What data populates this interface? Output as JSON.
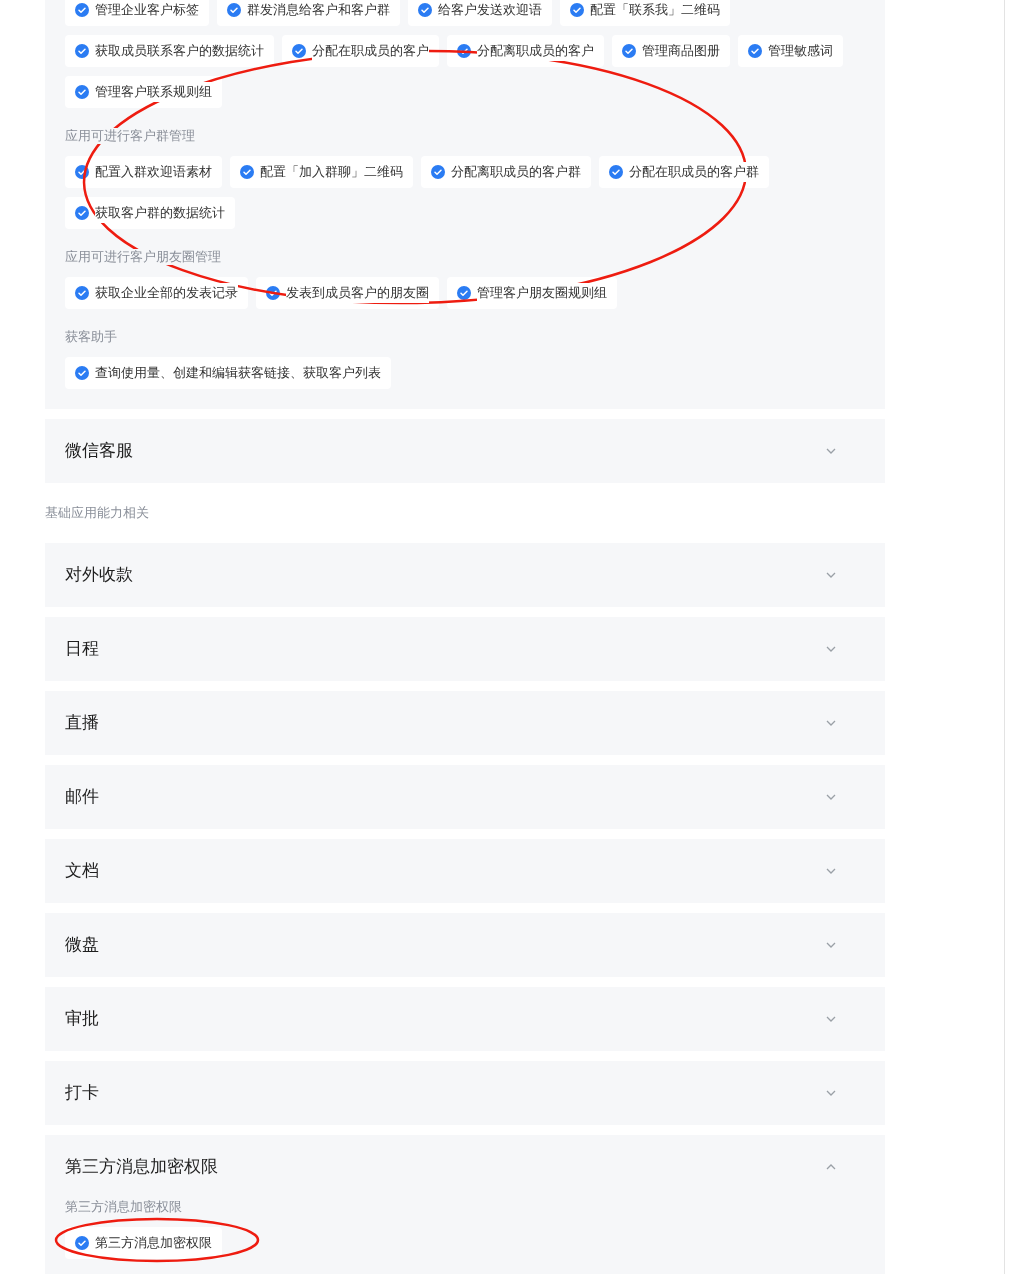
{
  "open_panel": {
    "expanded": true,
    "groups": [
      {
        "items": [
          {
            "label": "管理企业客户标签",
            "checked": true
          },
          {
            "label": "群发消息给客户和客户群",
            "checked": true
          },
          {
            "label": "给客户发送欢迎语",
            "checked": true
          },
          {
            "label": "配置「联系我」二维码",
            "checked": true
          },
          {
            "label": "获取成员联系客户的数据统计",
            "checked": true
          },
          {
            "label": "分配在职成员的客户",
            "checked": true
          },
          {
            "label": "分配离职成员的客户",
            "checked": true
          },
          {
            "label": "管理商品图册",
            "checked": true
          },
          {
            "label": "管理敏感词",
            "checked": true
          },
          {
            "label": "管理客户联系规则组",
            "checked": true
          }
        ]
      },
      {
        "label": "应用可进行客户群管理",
        "items": [
          {
            "label": "配置入群欢迎语素材",
            "checked": true
          },
          {
            "label": "配置「加入群聊」二维码",
            "checked": true
          },
          {
            "label": "分配离职成员的客户群",
            "checked": true
          },
          {
            "label": "分配在职成员的客户群",
            "checked": true
          },
          {
            "label": "获取客户群的数据统计",
            "checked": true
          }
        ]
      },
      {
        "label": "应用可进行客户朋友圈管理",
        "items": [
          {
            "label": "获取企业全部的发表记录",
            "checked": true
          },
          {
            "label": "发表到成员客户的朋友圈",
            "checked": true
          },
          {
            "label": "管理客户朋友圈规则组",
            "checked": true
          }
        ]
      },
      {
        "label": "获客助手",
        "items": [
          {
            "label": "查询使用量、创建和编辑获客链接、获取客户列表",
            "checked": true
          }
        ]
      }
    ]
  },
  "panels": [
    {
      "title": "微信客服",
      "expanded": false
    }
  ],
  "sections": [
    {
      "heading": "基础应用能力相关",
      "panels": [
        {
          "title": "对外收款",
          "expanded": false
        },
        {
          "title": "日程",
          "expanded": false
        },
        {
          "title": "直播",
          "expanded": false
        },
        {
          "title": "邮件",
          "expanded": false
        },
        {
          "title": "文档",
          "expanded": false
        },
        {
          "title": "微盘",
          "expanded": false
        },
        {
          "title": "审批",
          "expanded": false
        },
        {
          "title": "打卡",
          "expanded": false
        },
        {
          "title": "第三方消息加密权限",
          "expanded": true,
          "groups": [
            {
              "label": "第三方消息加密权限",
              "items": [
                {
                  "label": "第三方消息加密权限",
                  "checked": true
                }
              ]
            }
          ]
        }
      ]
    }
  ]
}
